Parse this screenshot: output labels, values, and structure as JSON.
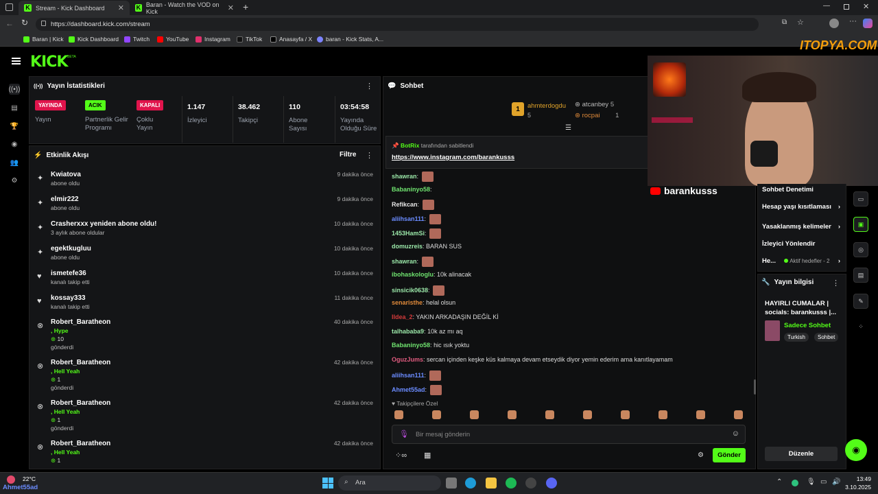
{
  "browser": {
    "tabs": [
      {
        "title": "Stream - Kick Dashboard"
      },
      {
        "title": "Baran - Watch the VOD on Kick"
      }
    ],
    "url": "https://dashboard.kick.com/stream",
    "bookmarks": [
      "Baran | Kick",
      "Kick Dashboard",
      "Twitch",
      "YouTube",
      "Instagram",
      "TikTok",
      "Anasayfa / X",
      "baran - Kick Stats, A..."
    ]
  },
  "app": {
    "logo": "KICK",
    "beta": "BETA"
  },
  "stats": {
    "title": "Yayın İstatistikleri",
    "items": [
      {
        "badge": "YAYINDA",
        "label": "Yayın"
      },
      {
        "badge": "ACIK",
        "label": "Partnerlik Gelir Programı"
      },
      {
        "badge": "KAPALI",
        "label": "Çoklu Yayın"
      },
      {
        "value": "1.147",
        "label": "İzleyici"
      },
      {
        "value": "38.462",
        "label": "Takipçi"
      },
      {
        "value": "110",
        "label": "Abone Sayısı"
      },
      {
        "value": "03:54:58",
        "label": "Yayında Olduğu Süre"
      }
    ],
    "colors": {
      "live": "#e0144c",
      "on": "#53fc18",
      "off": "#e0144c"
    }
  },
  "activity": {
    "title": "Etkinlik Akışı",
    "filter": "Filtre",
    "items": [
      {
        "icon": "sparkle-icon",
        "name": "Kwiatova",
        "sub": "abone oldu",
        "time": "9 dakika önce"
      },
      {
        "icon": "sparkle-icon",
        "name": "elmir222",
        "sub": "abone oldu",
        "time": "9 dakika önce"
      },
      {
        "icon": "sparkle-icon",
        "name": "Crasherxxx yeniden abone oldu!",
        "sub": "3 aylık abone oldular",
        "time": "10 dakika önce"
      },
      {
        "icon": "sparkle-icon",
        "name": "egektkugluu",
        "sub": "abone oldu",
        "time": "10 dakika önce"
      },
      {
        "icon": "heart-icon",
        "name": "ismetefe36",
        "sub": "kanalı takip etti",
        "time": "10 dakika önce"
      },
      {
        "icon": "heart-icon",
        "name": "kossay333",
        "sub": "kanalı takip etti",
        "time": "11 dakika önce"
      },
      {
        "icon": "kick-coin-icon",
        "name": "Robert_Baratheon",
        "sub": ", Hype",
        "amount": "10",
        "extra": "gönderdi",
        "time": "40 dakika önce"
      },
      {
        "icon": "kick-coin-icon",
        "name": "Robert_Baratheon",
        "sub": ", Hell Yeah",
        "amount": "1",
        "extra": "gönderdi",
        "time": "42 dakika önce"
      },
      {
        "icon": "kick-coin-icon",
        "name": "Robert_Baratheon",
        "sub": ", Hell Yeah",
        "amount": "1",
        "extra": "gönderdi",
        "time": "42 dakika önce"
      },
      {
        "icon": "kick-coin-icon",
        "name": "Robert_Baratheon",
        "sub": ", Hell Yeah",
        "amount": "1",
        "extra": "",
        "time": "42 dakika önce"
      }
    ]
  },
  "chat": {
    "title": "Sohbet",
    "leaders": [
      {
        "rank": "1",
        "name": "ahmterdogdu",
        "count": "5"
      },
      {
        "name": "atcanbey",
        "count": "5"
      },
      {
        "name": "rocpai",
        "count": "1"
      }
    ],
    "pinned_by": "BotRix",
    "pinned_suffix": "tarafından sabitlendi",
    "pinned_link": "https://www.instagram.com/barankusss",
    "messages": [
      {
        "user": "shawran",
        "text": "",
        "emote": true,
        "color": "#9be8a9"
      },
      {
        "user": "Babaninyo58",
        "text": "",
        "emote": false,
        "color": "#6fe36f"
      },
      {
        "user": "Refikcan",
        "text": "",
        "emote": true,
        "color": "#e6e6e6"
      },
      {
        "user": "aliihsan111",
        "text": "",
        "emote": true,
        "color": "#6b8cff"
      },
      {
        "user": "1453HamSi",
        "text": "",
        "emote": true,
        "color": "#9be8a9"
      },
      {
        "user": "domuzreis",
        "text": "BARAN SUS",
        "emote": false,
        "color": "#9be8a9"
      },
      {
        "user": "shawran",
        "text": "",
        "emote": true,
        "color": "#9be8a9"
      },
      {
        "user": "ibohaskologlu",
        "text": "10k alinacak",
        "emote": false,
        "color": "#6fe36f"
      },
      {
        "user": "sinsicik0638",
        "text": "",
        "emote": true,
        "color": "#9be8a9"
      },
      {
        "user": "senaristhe",
        "text": "helal olsun",
        "emote": false,
        "color": "#e08a3a"
      },
      {
        "user": "Ildea_2",
        "text": "YAKIN ARKADAŞIN DEĞİL Kİ",
        "emote": false,
        "color": "#d33a3a"
      },
      {
        "user": "talhababa9",
        "text": "10k az mı aq",
        "emote": false,
        "color": "#9be8a9"
      },
      {
        "user": "Babaninyo58",
        "text": "hic ısık yoktu",
        "emote": false,
        "color": "#6fe36f"
      },
      {
        "user": "OguzJums",
        "text": "sercan içinden keşke küs kalmaya devam etseydik diyor yemin ederim ama kanıtlayamam",
        "emote": false,
        "color": "#e05b7f"
      },
      {
        "user": "aliihsan111",
        "text": "",
        "emote": true,
        "color": "#6b8cff"
      },
      {
        "user": "Ahmet55ad",
        "text": "",
        "emote": true,
        "color": "#6b8cff"
      }
    ],
    "followers_only": "Takipçilere Özel",
    "input_placeholder": "Bir mesaj gönderin",
    "send": "Gönder"
  },
  "side": {
    "channel": "barankusss",
    "mod_title": "Sohbet Denetimi",
    "mod_items": [
      "Hesap yaşı kısıtlaması",
      "Yasaklanmış kelimeler",
      "İzleyici Yönlendir"
    ],
    "goals_label": "He...",
    "goals_value": "Aktif hedefler - 2",
    "info_title": "Yayın bilgisi",
    "stream_title": "HAYIRLI CUMALAR | socials: barankusss |...",
    "category": "Sadece Sohbet",
    "tags": [
      "Turkish",
      "Sohbet"
    ],
    "edit": "Düzenle"
  },
  "watermark": "ITOPYA.COM",
  "taskbar": {
    "weather": "22°C",
    "weather_sub": "Ahmet55ad",
    "search": "Ara",
    "time": "13:49",
    "date": "3.10.2025"
  }
}
